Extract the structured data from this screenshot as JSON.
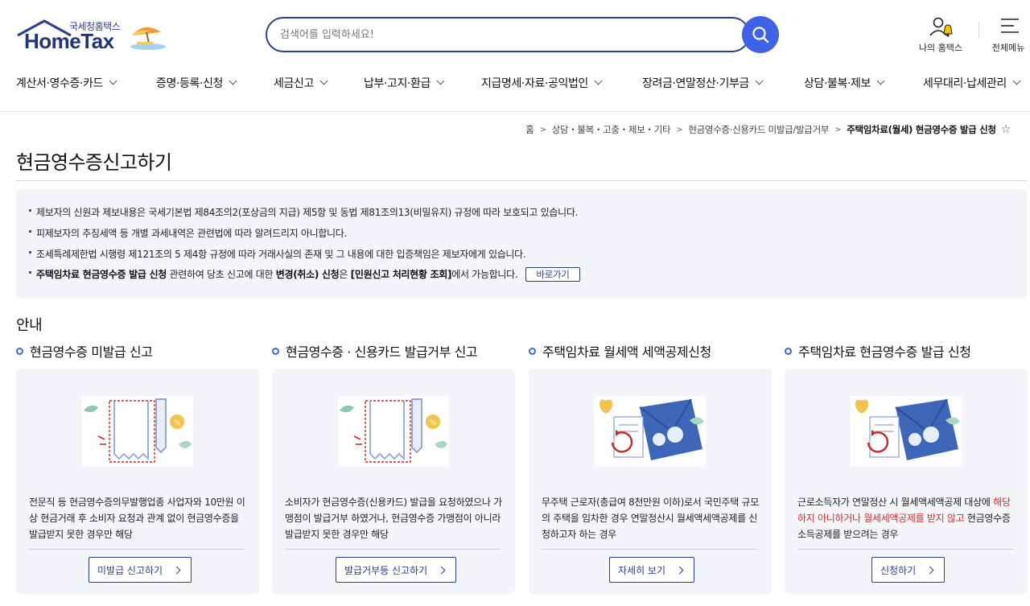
{
  "header": {
    "logo_sub": "국세청홈택스",
    "logo_main": "HomeTax",
    "search": {
      "placeholder": "검색어를 입력하세요!"
    },
    "my_hometax_label": "나의 홈택스",
    "all_menu_label": "전체메뉴"
  },
  "gnb": [
    {
      "label": "계산서·영수증·카드"
    },
    {
      "label": "증명·등록·신청"
    },
    {
      "label": "세금신고"
    },
    {
      "label": "납부·고지·환급"
    },
    {
      "label": "지급명세·자료·공익법인"
    },
    {
      "label": "장려금·연말정산·기부금"
    },
    {
      "label": "상담·불복·제보"
    },
    {
      "label": "세무대리·납세관리"
    }
  ],
  "breadcrumb": {
    "items": [
      "홈",
      "상담・불복・고충・제보・기타",
      "현금영수증·신용카드 미발급/발급거부"
    ],
    "current": "주택임차료(월세) 현금영수증 발급 신청"
  },
  "page_title": "현금영수증신고하기",
  "notice": {
    "items": [
      "제보자의 신원과 제보내용은 국세기본법 제84조의2(포상금의 지급) 제5항 및 동법 제81조의13(비밀유지) 규정에 따라 보호되고 있습니다.",
      "피제보자의 추징세액 등 개별 과세내역은 관련법에 따라 알려드리지 아니합니다.",
      "조세특례제한법 시행령 제121조의 5 제4항 규정에 따라 거래사실의 존재 및 그 내용에 대한 입증책임은 제보자에게 있습니다."
    ],
    "last": {
      "bold1": "주택임차료 현금영수증 발급 신청",
      "text1": " 관련하여 당초 신고에 대한 ",
      "bold2": "변경(취소) 신청",
      "text2": "은 ",
      "bold3": "[민원신고 처리현황 조회]",
      "text3": "에서 가능합니다.",
      "button": "바로가기"
    }
  },
  "guide_title": "안내",
  "cards": [
    {
      "heading": "현금영수증 미발급 신고",
      "desc": "전문직 등 현금영수증의무발행업종 사업자와 10만원 이상 현금거래 후 소비자 요청과 관계 없이 현금영수증을 발급받지 못한 경우만 해당",
      "button": "미발급 신고하기"
    },
    {
      "heading": "현금영수증 · 신용카드 발급거부 신고",
      "desc": "소비자가 현금영수증(신용카드) 발급을 요청하였으나 가맹점이 발급거부 하였거나, 현금영수증 가맹점이 아니라 발급받지 못한 경우만 해당",
      "button": "발급거부등 신고하기"
    },
    {
      "heading": "주택임차료 월세액 세액공제신청",
      "desc": "무주택 근로자(총급여 8천만원 이하)로서 국민주택 규모의 주택을 임차한 경우 연말정산시 월세액세액공제를 신청하고자 하는 경우",
      "button": "자세히 보기"
    },
    {
      "heading": "주택임차료 현금영수증 발급 신청",
      "desc_pre": "근로소득자가 연말정산 시 월세액세액공제 대상에 ",
      "desc_red": "해당하지 아니하거나 월세세액공제를 받지 않고",
      "desc_post": " 현금영수증 소득공제를 받으려는 경우",
      "button": "신청하기"
    }
  ],
  "icons": [
    "home-roof-icon",
    "beach-umbrella-icon",
    "search-icon",
    "user-bell-icon",
    "hamburger-menu-icon",
    "chevron-down-icon",
    "star-icon",
    "ring-bullet-icon",
    "receipt-illustration",
    "envelope-refresh-illustration",
    "chevron-right-icon"
  ],
  "colors": {
    "brand_navy": "#2c3f8d",
    "accent_blue": "#3e63e6",
    "panel_bg": "#f3f5f9",
    "alert_red": "#d03030"
  }
}
